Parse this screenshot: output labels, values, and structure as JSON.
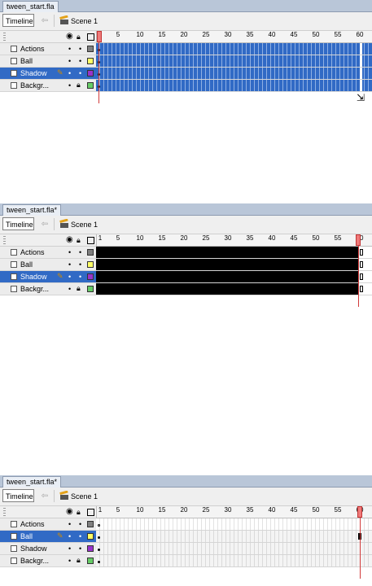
{
  "panels": [
    {
      "file_tab": "tween_start.fla",
      "timeline_button": "Timeline",
      "scene_label": "Scene 1",
      "ruler_labels": [
        "1",
        "5",
        "10",
        "15",
        "20",
        "25",
        "30",
        "35",
        "40",
        "45",
        "50",
        "55",
        "60"
      ],
      "selected_layer": "Shadow",
      "frames_state": "selected-blue",
      "layers": [
        {
          "name": "Actions",
          "color": "#808080",
          "locked": false
        },
        {
          "name": "Ball",
          "color": "#ffff66",
          "locked": false
        },
        {
          "name": "Shadow",
          "color": "#9933cc",
          "locked": false
        },
        {
          "name": "Backgr...",
          "color": "#66cc66",
          "locked": true
        }
      ]
    },
    {
      "file_tab": "tween_start.fla*",
      "timeline_button": "Timeline",
      "scene_label": "Scene 1",
      "ruler_labels": [
        "1",
        "5",
        "10",
        "15",
        "20",
        "25",
        "30",
        "35",
        "40",
        "45",
        "50",
        "55",
        "60"
      ],
      "selected_layer": "Shadow",
      "frames_state": "selected-black",
      "layers": [
        {
          "name": "Actions",
          "color": "#808080",
          "locked": false
        },
        {
          "name": "Ball",
          "color": "#ffff66",
          "locked": false
        },
        {
          "name": "Shadow",
          "color": "#9933cc",
          "locked": false
        },
        {
          "name": "Backgr...",
          "color": "#66cc66",
          "locked": true
        }
      ]
    },
    {
      "file_tab": "tween_start.fla*",
      "timeline_button": "Timeline",
      "scene_label": "Scene 1",
      "ruler_labels": [
        "1",
        "5",
        "10",
        "15",
        "20",
        "25",
        "30",
        "35",
        "40",
        "45",
        "50",
        "55",
        "60"
      ],
      "selected_layer": "Ball",
      "frames_state": "tweened",
      "layers": [
        {
          "name": "Actions",
          "color": "#808080",
          "locked": false
        },
        {
          "name": "Ball",
          "color": "#ffff66",
          "locked": false
        },
        {
          "name": "Shadow",
          "color": "#9933cc",
          "locked": false
        },
        {
          "name": "Backgr...",
          "color": "#66cc66",
          "locked": true
        }
      ]
    }
  ],
  "colors": {
    "selection_blue": "#316ac5",
    "playhead_red": "#d23b3b"
  }
}
